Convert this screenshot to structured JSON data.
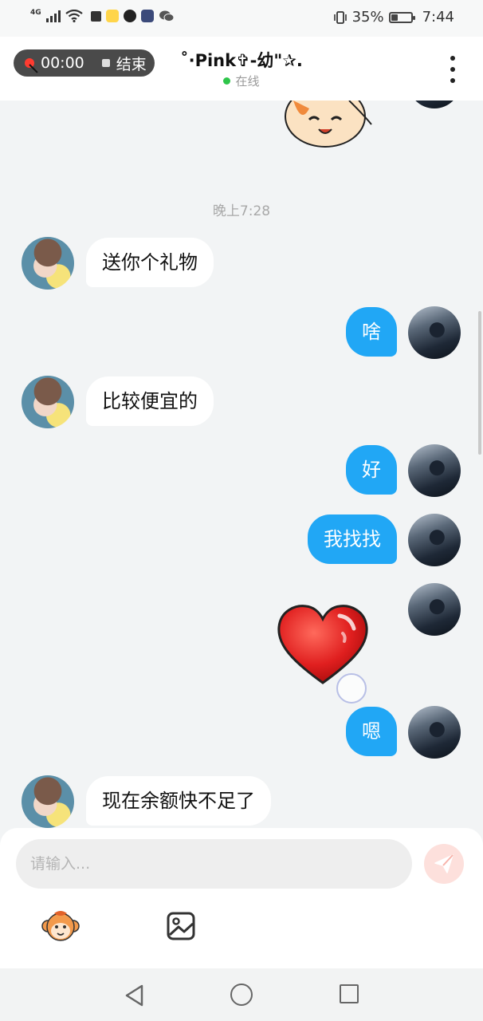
{
  "status_bar": {
    "network": "4G",
    "battery": "35%",
    "battery_level": 0.35,
    "time": "7:44"
  },
  "header": {
    "recording_time": "00:00",
    "stop_label": "结束",
    "chat_title": "˚·Pink✞-幼\"✰.",
    "presence": "在线"
  },
  "messages": [
    {
      "type": "timestamp",
      "text": "晚上7:28"
    },
    {
      "type": "incoming",
      "text": "送你个礼物"
    },
    {
      "type": "outgoing",
      "text": "啥"
    },
    {
      "type": "incoming",
      "text": "比较便宜的"
    },
    {
      "type": "outgoing",
      "text": "好"
    },
    {
      "type": "outgoing",
      "text": "我找找"
    },
    {
      "type": "outgoing",
      "sticker": "heart-sticker"
    },
    {
      "type": "outgoing",
      "text": "嗯"
    },
    {
      "type": "incoming",
      "text": "现在余额快不足了"
    }
  ],
  "composer": {
    "placeholder": "请输入..."
  },
  "icons": {
    "send": "send-icon",
    "emoji": "monkey-emoji-icon",
    "image": "image-icon"
  },
  "colors": {
    "outgoing_bubble": "#21a7f5",
    "incoming_bubble": "#ffffff",
    "online": "#2ec54a",
    "record": "#ff3b30"
  }
}
